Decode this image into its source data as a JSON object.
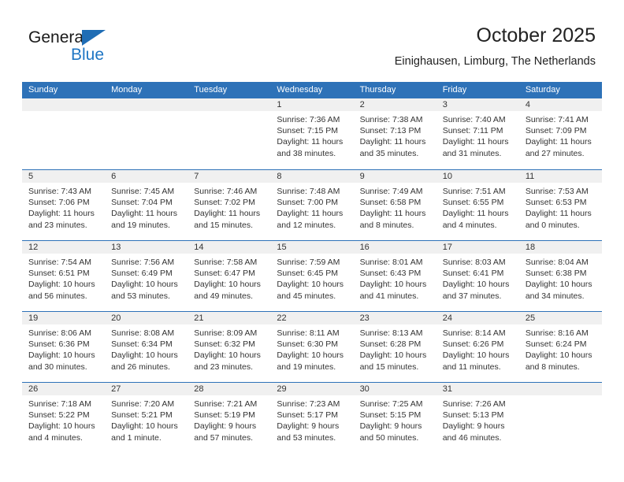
{
  "brand": {
    "name_part1": "General",
    "name_part2": "Blue",
    "triangle_color": "#1f6db5",
    "blue_color": "#1f76c4"
  },
  "header": {
    "title": "October 2025",
    "subtitle": "Einighausen, Limburg, The Netherlands"
  },
  "theme": {
    "header_blue": "#2e72b8",
    "date_band_gray": "#f0f0f0",
    "text_color": "#333333"
  },
  "weekday_headers": [
    "Sunday",
    "Monday",
    "Tuesday",
    "Wednesday",
    "Thursday",
    "Friday",
    "Saturday"
  ],
  "weeks": [
    [
      {
        "date": "",
        "lines": []
      },
      {
        "date": "",
        "lines": []
      },
      {
        "date": "",
        "lines": []
      },
      {
        "date": "1",
        "lines": [
          "Sunrise: 7:36 AM",
          "Sunset: 7:15 PM",
          "Daylight: 11 hours",
          "and 38 minutes."
        ]
      },
      {
        "date": "2",
        "lines": [
          "Sunrise: 7:38 AM",
          "Sunset: 7:13 PM",
          "Daylight: 11 hours",
          "and 35 minutes."
        ]
      },
      {
        "date": "3",
        "lines": [
          "Sunrise: 7:40 AM",
          "Sunset: 7:11 PM",
          "Daylight: 11 hours",
          "and 31 minutes."
        ]
      },
      {
        "date": "4",
        "lines": [
          "Sunrise: 7:41 AM",
          "Sunset: 7:09 PM",
          "Daylight: 11 hours",
          "and 27 minutes."
        ]
      }
    ],
    [
      {
        "date": "5",
        "lines": [
          "Sunrise: 7:43 AM",
          "Sunset: 7:06 PM",
          "Daylight: 11 hours",
          "and 23 minutes."
        ]
      },
      {
        "date": "6",
        "lines": [
          "Sunrise: 7:45 AM",
          "Sunset: 7:04 PM",
          "Daylight: 11 hours",
          "and 19 minutes."
        ]
      },
      {
        "date": "7",
        "lines": [
          "Sunrise: 7:46 AM",
          "Sunset: 7:02 PM",
          "Daylight: 11 hours",
          "and 15 minutes."
        ]
      },
      {
        "date": "8",
        "lines": [
          "Sunrise: 7:48 AM",
          "Sunset: 7:00 PM",
          "Daylight: 11 hours",
          "and 12 minutes."
        ]
      },
      {
        "date": "9",
        "lines": [
          "Sunrise: 7:49 AM",
          "Sunset: 6:58 PM",
          "Daylight: 11 hours",
          "and 8 minutes."
        ]
      },
      {
        "date": "10",
        "lines": [
          "Sunrise: 7:51 AM",
          "Sunset: 6:55 PM",
          "Daylight: 11 hours",
          "and 4 minutes."
        ]
      },
      {
        "date": "11",
        "lines": [
          "Sunrise: 7:53 AM",
          "Sunset: 6:53 PM",
          "Daylight: 11 hours",
          "and 0 minutes."
        ]
      }
    ],
    [
      {
        "date": "12",
        "lines": [
          "Sunrise: 7:54 AM",
          "Sunset: 6:51 PM",
          "Daylight: 10 hours",
          "and 56 minutes."
        ]
      },
      {
        "date": "13",
        "lines": [
          "Sunrise: 7:56 AM",
          "Sunset: 6:49 PM",
          "Daylight: 10 hours",
          "and 53 minutes."
        ]
      },
      {
        "date": "14",
        "lines": [
          "Sunrise: 7:58 AM",
          "Sunset: 6:47 PM",
          "Daylight: 10 hours",
          "and 49 minutes."
        ]
      },
      {
        "date": "15",
        "lines": [
          "Sunrise: 7:59 AM",
          "Sunset: 6:45 PM",
          "Daylight: 10 hours",
          "and 45 minutes."
        ]
      },
      {
        "date": "16",
        "lines": [
          "Sunrise: 8:01 AM",
          "Sunset: 6:43 PM",
          "Daylight: 10 hours",
          "and 41 minutes."
        ]
      },
      {
        "date": "17",
        "lines": [
          "Sunrise: 8:03 AM",
          "Sunset: 6:41 PM",
          "Daylight: 10 hours",
          "and 37 minutes."
        ]
      },
      {
        "date": "18",
        "lines": [
          "Sunrise: 8:04 AM",
          "Sunset: 6:38 PM",
          "Daylight: 10 hours",
          "and 34 minutes."
        ]
      }
    ],
    [
      {
        "date": "19",
        "lines": [
          "Sunrise: 8:06 AM",
          "Sunset: 6:36 PM",
          "Daylight: 10 hours",
          "and 30 minutes."
        ]
      },
      {
        "date": "20",
        "lines": [
          "Sunrise: 8:08 AM",
          "Sunset: 6:34 PM",
          "Daylight: 10 hours",
          "and 26 minutes."
        ]
      },
      {
        "date": "21",
        "lines": [
          "Sunrise: 8:09 AM",
          "Sunset: 6:32 PM",
          "Daylight: 10 hours",
          "and 23 minutes."
        ]
      },
      {
        "date": "22",
        "lines": [
          "Sunrise: 8:11 AM",
          "Sunset: 6:30 PM",
          "Daylight: 10 hours",
          "and 19 minutes."
        ]
      },
      {
        "date": "23",
        "lines": [
          "Sunrise: 8:13 AM",
          "Sunset: 6:28 PM",
          "Daylight: 10 hours",
          "and 15 minutes."
        ]
      },
      {
        "date": "24",
        "lines": [
          "Sunrise: 8:14 AM",
          "Sunset: 6:26 PM",
          "Daylight: 10 hours",
          "and 11 minutes."
        ]
      },
      {
        "date": "25",
        "lines": [
          "Sunrise: 8:16 AM",
          "Sunset: 6:24 PM",
          "Daylight: 10 hours",
          "and 8 minutes."
        ]
      }
    ],
    [
      {
        "date": "26",
        "lines": [
          "Sunrise: 7:18 AM",
          "Sunset: 5:22 PM",
          "Daylight: 10 hours",
          "and 4 minutes."
        ]
      },
      {
        "date": "27",
        "lines": [
          "Sunrise: 7:20 AM",
          "Sunset: 5:21 PM",
          "Daylight: 10 hours",
          "and 1 minute."
        ]
      },
      {
        "date": "28",
        "lines": [
          "Sunrise: 7:21 AM",
          "Sunset: 5:19 PM",
          "Daylight: 9 hours",
          "and 57 minutes."
        ]
      },
      {
        "date": "29",
        "lines": [
          "Sunrise: 7:23 AM",
          "Sunset: 5:17 PM",
          "Daylight: 9 hours",
          "and 53 minutes."
        ]
      },
      {
        "date": "30",
        "lines": [
          "Sunrise: 7:25 AM",
          "Sunset: 5:15 PM",
          "Daylight: 9 hours",
          "and 50 minutes."
        ]
      },
      {
        "date": "31",
        "lines": [
          "Sunrise: 7:26 AM",
          "Sunset: 5:13 PM",
          "Daylight: 9 hours",
          "and 46 minutes."
        ]
      },
      {
        "date": "",
        "lines": []
      }
    ]
  ]
}
